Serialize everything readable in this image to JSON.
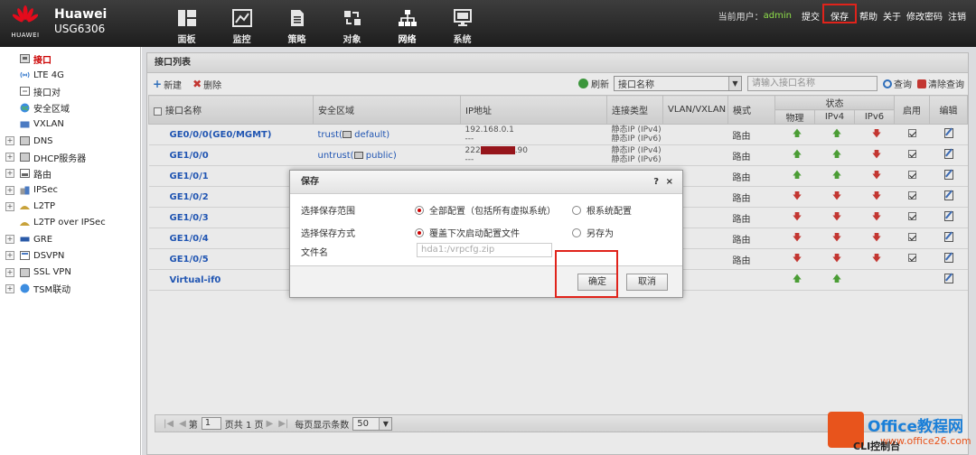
{
  "brand": {
    "logo_text": "HUAWEI",
    "name": "Huawei",
    "model": "USG6306"
  },
  "nav": [
    {
      "label": "面板",
      "icon": "dashboard-icon"
    },
    {
      "label": "监控",
      "icon": "monitor-chart-icon"
    },
    {
      "label": "策略",
      "icon": "policy-doc-icon"
    },
    {
      "label": "对象",
      "icon": "object-icon"
    },
    {
      "label": "网络",
      "icon": "network-icon"
    },
    {
      "label": "系统",
      "icon": "system-monitor-icon"
    }
  ],
  "topright": {
    "user_label": "当前用户：",
    "user": "admin",
    "submit": "提交",
    "save": "保存",
    "help": "帮助",
    "about": "关于",
    "change_pwd": "修改密码",
    "logout": "注销"
  },
  "sidebar": [
    {
      "label": "接口",
      "expandable": false,
      "active": true
    },
    {
      "label": "LTE 4G",
      "expandable": false
    },
    {
      "label": "接口对",
      "expandable": false
    },
    {
      "label": "安全区域",
      "expandable": false
    },
    {
      "label": "VXLAN",
      "expandable": false
    },
    {
      "label": "DNS",
      "expandable": true
    },
    {
      "label": "DHCP服务器",
      "expandable": true
    },
    {
      "label": "路由",
      "expandable": true
    },
    {
      "label": "IPSec",
      "expandable": true
    },
    {
      "label": "L2TP",
      "expandable": true
    },
    {
      "label": "L2TP over IPSec",
      "expandable": false,
      "sub": true
    },
    {
      "label": "GRE",
      "expandable": true
    },
    {
      "label": "DSVPN",
      "expandable": true
    },
    {
      "label": "SSL VPN",
      "expandable": true
    },
    {
      "label": "TSM联动",
      "expandable": true
    }
  ],
  "panel": {
    "title": "接口列表"
  },
  "toolbar": {
    "new": "新建",
    "delete": "删除",
    "refresh": "刷新",
    "filter_select": "接口名称",
    "search_placeholder": "请输入接口名称",
    "query": "查询",
    "clear_query": "清除查询"
  },
  "table": {
    "headers": {
      "name": "接口名称",
      "zone": "安全区域",
      "ip": "IP地址",
      "conn_type": "连接类型",
      "vlan": "VLAN/VXLAN",
      "mode": "模式",
      "status": "状态",
      "physical": "物理",
      "ipv4": "IPv4",
      "ipv6": "IPv6",
      "enabled": "启用",
      "edit": "编辑"
    },
    "rows": [
      {
        "name": "GE0/0/0(GE0/MGMT)",
        "zone": "trust(",
        "zone_vsys": "default)",
        "ip1": "192.168.0.1",
        "ip2": "---",
        "ct1": "静态IP (IPv4)",
        "ct2": "静态IP (IPv6)",
        "mode": "路由",
        "phys": "up",
        "ipv4": "up",
        "ipv6": "down",
        "enabled": true
      },
      {
        "name": "GE1/0/0",
        "zone": "untrust(",
        "zone_vsys": "public)",
        "ip1a": "222",
        "ip1b": ".90",
        "ip2": "---",
        "ct1": "静态IP (IPv4)",
        "ct2": "静态IP (IPv6)",
        "mode": "路由",
        "phys": "up",
        "ipv4": "up",
        "ipv6": "down",
        "enabled": true
      },
      {
        "name": "GE1/0/1",
        "mode": "路由",
        "phys": "up",
        "ipv4": "up",
        "ipv6": "down",
        "enabled": true
      },
      {
        "name": "GE1/0/2",
        "mode": "路由",
        "phys": "down",
        "ipv4": "down",
        "ipv6": "down",
        "enabled": true
      },
      {
        "name": "GE1/0/3",
        "mode": "路由",
        "phys": "down",
        "ipv4": "down",
        "ipv6": "down",
        "enabled": true
      },
      {
        "name": "GE1/0/4",
        "mode": "路由",
        "phys": "down",
        "ipv4": "down",
        "ipv6": "down",
        "enabled": true
      },
      {
        "name": "GE1/0/5",
        "mode": "路由",
        "phys": "down",
        "ipv4": "down",
        "ipv6": "down",
        "enabled": true
      },
      {
        "name": "Virtual-if0",
        "phys": "up",
        "ipv4": "up",
        "enabled": false
      }
    ]
  },
  "pager": {
    "page_prefix": "第",
    "page": "1",
    "page_total": "页共 1 页",
    "per_page_label": "每页显示条数",
    "per_page": "50"
  },
  "dialog": {
    "title": "保存",
    "help": "?",
    "close": "×",
    "scope_label": "选择保存范围",
    "scope_opt1": "全部配置（包括所有虚拟系统）",
    "scope_opt2": "根系统配置",
    "method_label": "选择保存方式",
    "method_opt1": "覆盖下次启动配置文件",
    "method_opt2": "另存为",
    "file_label": "文件名",
    "file_value": "hda1:/vrpcfg.zip",
    "ok": "确定",
    "cancel": "取消"
  },
  "bottom": {
    "cli": "CLI控制台",
    "watermark_main": "Office教程网",
    "watermark_url": "www.office26.com"
  }
}
